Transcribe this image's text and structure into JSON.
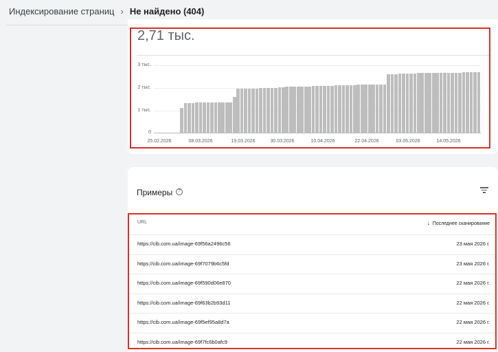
{
  "breadcrumb": {
    "parent": "Индексирование страниц",
    "separator": "›",
    "current": "Не найдено (404)"
  },
  "summary": {
    "count": "2,71 тыс."
  },
  "chart_data": {
    "type": "bar",
    "y_ticks": [
      "3 тыс.",
      "2 тыс.",
      "1 тыс.",
      "0"
    ],
    "x_ticks": [
      "25.02.2026",
      "08.03.2026",
      "19.03.2026",
      "30.03.2026",
      "10.04.2026",
      "22.04.2026",
      "03.05.2026",
      "14.05.2026"
    ],
    "ylim": [
      0,
      3000
    ],
    "start_date": "25.02.2026",
    "values": [
      0,
      0,
      0,
      0,
      0,
      0,
      0,
      1100,
      1330,
      1330,
      1330,
      1340,
      1340,
      1340,
      1340,
      1350,
      1350,
      1350,
      1350,
      1350,
      1350,
      1600,
      1950,
      1950,
      1950,
      1950,
      1960,
      1970,
      1980,
      1990,
      2000,
      2000,
      2000,
      2010,
      2030,
      2040,
      2040,
      2050,
      2050,
      2050,
      2060,
      2060,
      2070,
      2070,
      2080,
      2080,
      2090,
      2090,
      2100,
      2100,
      2100,
      2110,
      2110,
      2120,
      2130,
      2130,
      2130,
      2140,
      2140,
      2150,
      2150,
      2150,
      2610,
      2610,
      2610,
      2620,
      2640,
      2640,
      2640,
      2640,
      2650,
      2650,
      2650,
      2650,
      2660,
      2660,
      2660,
      2660,
      2670,
      2670,
      2670,
      2670,
      2680,
      2680,
      2680,
      2690,
      2690
    ],
    "grid": true,
    "legend": "none",
    "bar_color": "#bdbdbd"
  },
  "examples": {
    "title": "Примеры",
    "help_icon": "help-icon",
    "filter_icon": "filter-icon",
    "columns": {
      "url": "URL",
      "date": "Последнее сканирование",
      "sort_icon": "arrow-down-icon"
    },
    "rows": [
      {
        "url": "https://cib.com.ua/image-69f56a2496c56",
        "date": "23 мая 2026 г."
      },
      {
        "url": "https://cib.com.ua/image-69f7079b6c5fd",
        "date": "23 мая 2026 г."
      },
      {
        "url": "https://cib.com.ua/image-69f590d06e870",
        "date": "22 мая 2026 г."
      },
      {
        "url": "https://cib.com.ua/image-69f63b2b93d11",
        "date": "22 мая 2026 г."
      },
      {
        "url": "https://cib.com.ua/image-69f5ef95a8d7a",
        "date": "22 мая 2026 г."
      },
      {
        "url": "https://cib.com.ua/image-69f7fc6b0afc9",
        "date": "22 мая 2026 г."
      }
    ]
  },
  "colors": {
    "highlight": "#d93025",
    "bar": "#bdbdbd",
    "background": "#f1f3f4"
  }
}
